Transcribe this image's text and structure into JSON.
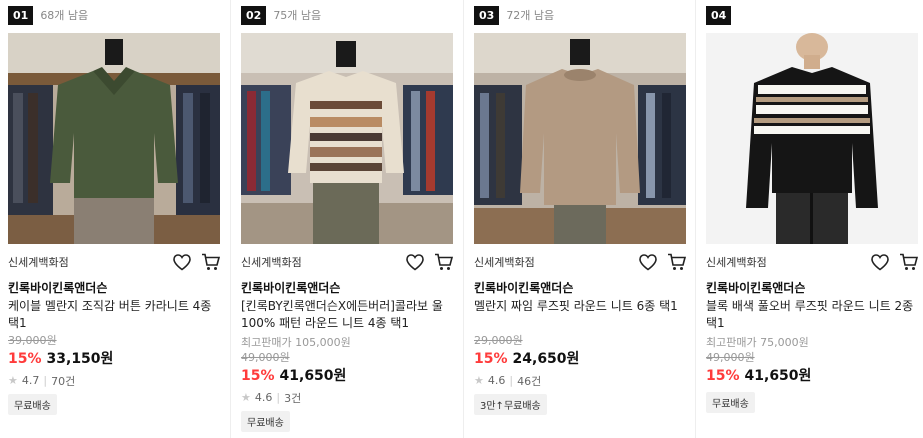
{
  "products": [
    {
      "rank": "01",
      "remaining": "68개 남음",
      "store": "신세계백화점",
      "brand": "킨록바이킨록앤더슨",
      "name": "케이블 멜란지 조직감 버튼 카라니트 4종 택1",
      "best_price_label": "",
      "original_price": "39,000원",
      "discount": "15%",
      "price": "33,150원",
      "rating": "4.7",
      "reviews": "70건",
      "badge": "무료배송",
      "image": "green-knit-collar-sweater"
    },
    {
      "rank": "02",
      "remaining": "75개 남음",
      "store": "신세계백화점",
      "brand": "킨록바이킨록앤더슨",
      "name": "[킨록BY킨록앤더슨X에든버러]콜라보 울 100% 패턴 라운드 니트 4종 택1",
      "best_price_label": "최고판매가 105,000원",
      "original_price": "49,000원",
      "discount": "15%",
      "price": "41,650원",
      "rating": "4.6",
      "reviews": "3건",
      "badge": "무료배송",
      "image": "fair-isle-pattern-sweater"
    },
    {
      "rank": "03",
      "remaining": "72개 남음",
      "store": "신세계백화점",
      "brand": "킨록바이킨록앤더슨",
      "name": "멜란지 짜임 루즈핏 라운드 니트 6종 택1",
      "best_price_label": "",
      "original_price": "29,000원",
      "discount": "15%",
      "price": "24,650원",
      "rating": "4.6",
      "reviews": "46건",
      "badge": "3만↑무료배송",
      "image": "beige-melange-sweater"
    },
    {
      "rank": "04",
      "remaining": "",
      "store": "신세계백화점",
      "brand": "킨록바이킨록앤더슨",
      "name": "블록 배색 풀오버 루즈핏 라운드 니트 2종 택1",
      "best_price_label": "최고판매가 75,000원",
      "original_price": "49,000원",
      "discount": "15%",
      "price": "41,650원",
      "rating": "",
      "reviews": "",
      "badge": "무료배송",
      "image": "black-striped-sweater"
    }
  ],
  "icons": {
    "wishlist": "heart-icon",
    "cart": "cart-icon",
    "star": "star-icon"
  },
  "colors": {
    "discount": "#ff3b3b",
    "rank_bg": "#111111"
  }
}
